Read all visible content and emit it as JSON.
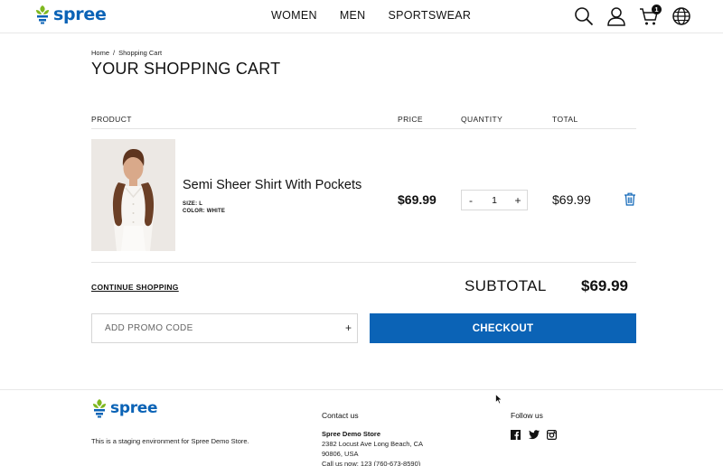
{
  "header": {
    "logo_text": "spree",
    "nav": [
      "WOMEN",
      "MEN",
      "SPORTSWEAR"
    ],
    "icons": [
      "search-icon",
      "account-icon",
      "cart-icon",
      "globe-icon"
    ],
    "cart_count": "1"
  },
  "breadcrumb": {
    "home": "Home",
    "separator": "/",
    "current": "Shopping Cart"
  },
  "page_title": "YOUR SHOPPING CART",
  "table": {
    "headers": {
      "product": "PRODUCT",
      "price": "PRICE",
      "quantity": "QUANTITY",
      "total": "TOTAL"
    },
    "items": [
      {
        "name": "Semi Sheer Shirt With Pockets",
        "size": "SIZE: L",
        "color": "COLOR: WHITE",
        "price": "$69.99",
        "quantity": "1",
        "total": "$69.99"
      }
    ]
  },
  "continue_shopping": "CONTINUE SHOPPING",
  "subtotal": {
    "label": "SUBTOTAL",
    "value": "$69.99"
  },
  "promo": {
    "placeholder": "ADD PROMO CODE",
    "add_symbol": "+"
  },
  "checkout_label": "CHECKOUT",
  "footer": {
    "logo_text": "spree",
    "note": "This is a staging environment for Spree Demo Store.",
    "contact_title": "Contact us",
    "store_name": "Spree Demo Store",
    "address_line1": "2382 Locust Ave Long Beach, CA",
    "address_line2": "90806, USA",
    "phone": "Call us now: 123 (760-673-8590)",
    "follow_title": "Follow us",
    "social": [
      "facebook-icon",
      "twitter-icon",
      "instagram-icon"
    ]
  },
  "colors": {
    "brand_blue": "#0b63b6",
    "logo_green": "#7fb81f"
  }
}
